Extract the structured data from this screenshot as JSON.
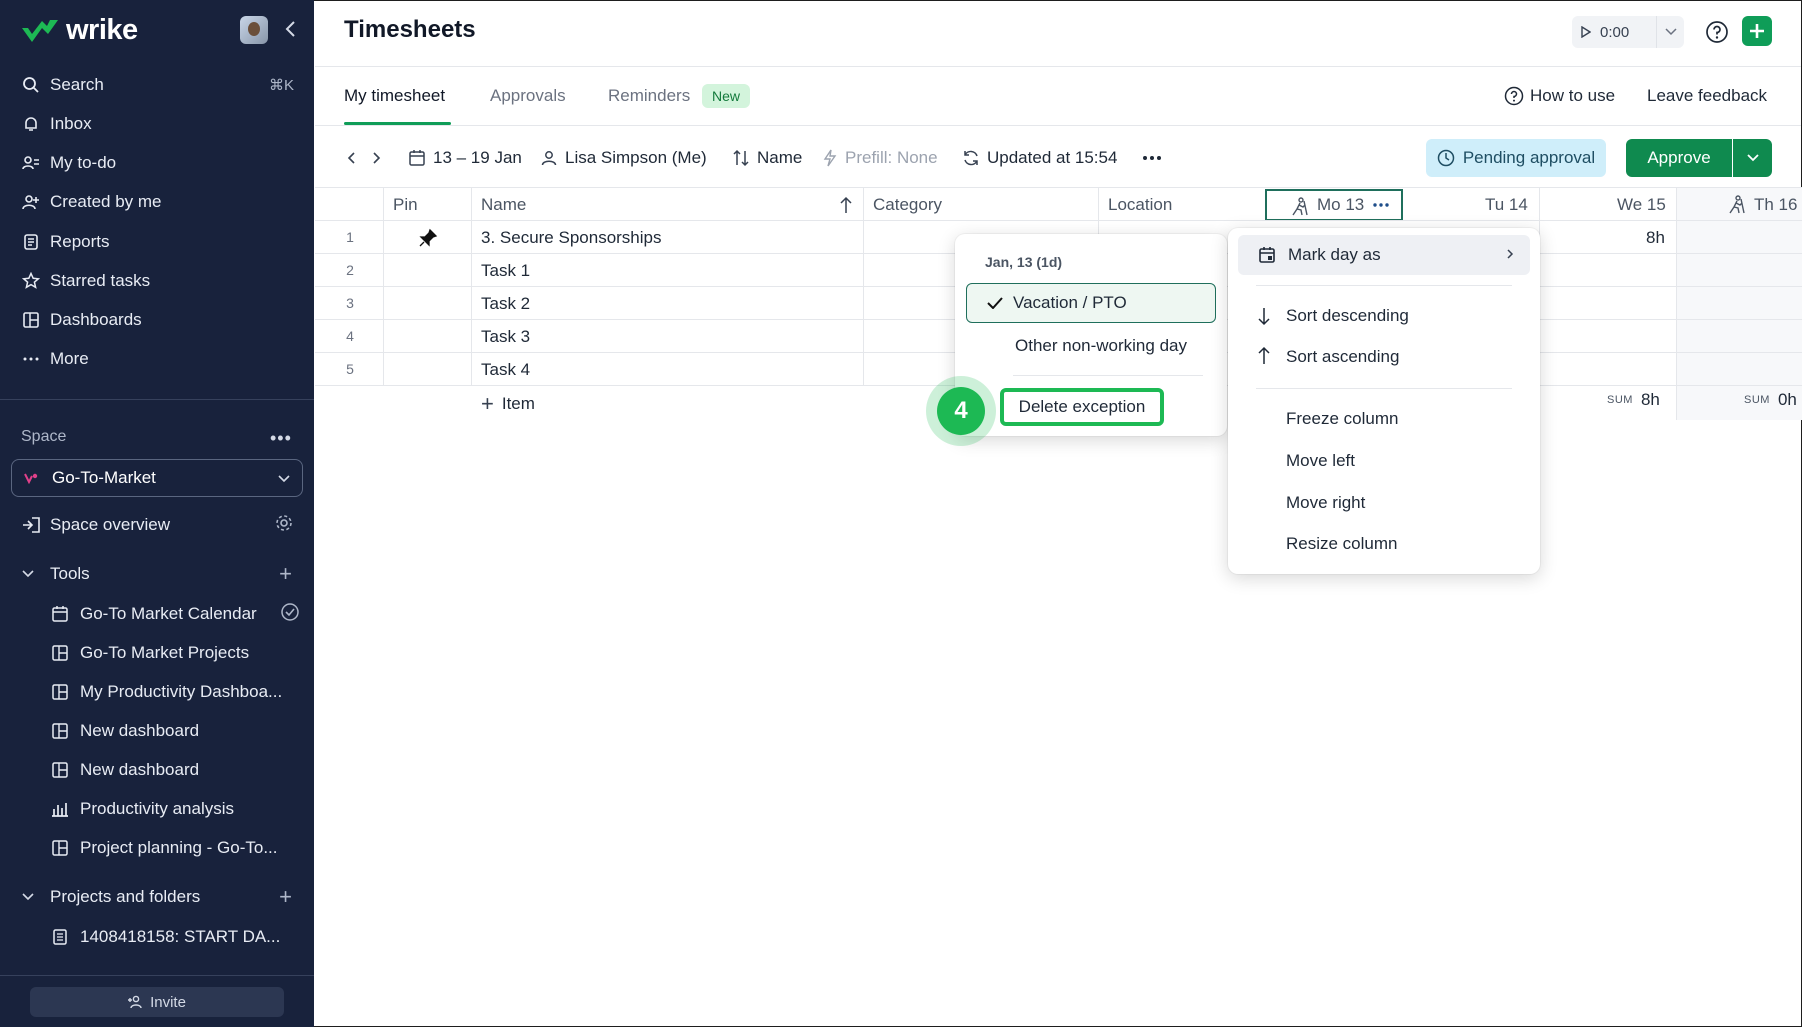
{
  "sidebar": {
    "logo": "wrike",
    "nav": [
      {
        "label": "Search",
        "icon": "search-icon",
        "shortcut": "⌘K"
      },
      {
        "label": "Inbox",
        "icon": "bell-icon"
      },
      {
        "label": "My to-do",
        "icon": "todo-icon"
      },
      {
        "label": "Created by me",
        "icon": "user-plus-icon"
      },
      {
        "label": "Reports",
        "icon": "report-icon"
      },
      {
        "label": "Starred tasks",
        "icon": "star-icon"
      },
      {
        "label": "Dashboards",
        "icon": "dashboard-icon"
      },
      {
        "label": "More",
        "icon": "more-icon"
      }
    ],
    "space_label": "Space",
    "space_name": "Go-To-Market",
    "space_overview": "Space overview",
    "tools_label": "Tools",
    "tools": [
      {
        "label": "Go-To Market Calendar",
        "icon": "calendar-icon"
      },
      {
        "label": "Go-To Market Projects",
        "icon": "board-icon"
      },
      {
        "label": "My Productivity Dashboa...",
        "icon": "board-icon"
      },
      {
        "label": "New dashboard",
        "icon": "board-icon"
      },
      {
        "label": "New dashboard",
        "icon": "board-icon"
      },
      {
        "label": "Productivity analysis",
        "icon": "chart-icon"
      },
      {
        "label": "Project planning - Go-To...",
        "icon": "board-icon"
      }
    ],
    "projects_label": "Projects and folders",
    "projects": [
      {
        "label": "1408418158: START DA...",
        "icon": "project-icon"
      }
    ],
    "invite": "Invite"
  },
  "header": {
    "title": "Timesheets",
    "timer_value": "0:00"
  },
  "tabs": {
    "items": [
      "My timesheet",
      "Approvals",
      "Reminders"
    ],
    "new_badge": "New",
    "how_to_use": "How to use",
    "leave_feedback": "Leave feedback"
  },
  "toolbar": {
    "date_range": "13 – 19 Jan",
    "user": "Lisa Simpson (Me)",
    "sort": "Name",
    "prefill": "Prefill: None",
    "updated": "Updated at 15:54",
    "pending": "Pending approval",
    "approve": "Approve"
  },
  "grid": {
    "columns": {
      "pin": "Pin",
      "name": "Name",
      "category": "Category",
      "location": "Location",
      "mo": "Mo 13",
      "tu": "Tu 14",
      "we": "We 15",
      "th": "Th 16"
    },
    "rows": [
      {
        "num": "1",
        "name": "3. Secure Sponsorships",
        "we": "8h"
      },
      {
        "num": "2",
        "name": "Task 1"
      },
      {
        "num": "3",
        "name": "Task 2"
      },
      {
        "num": "4",
        "name": "Task 3"
      },
      {
        "num": "5",
        "name": "Task 4"
      }
    ],
    "add_item": "Item",
    "sum_label": "SUM",
    "sum_we": "8h",
    "sum_th": "0h"
  },
  "menu_left": {
    "title": "Jan, 13 (1d)",
    "selected": "Vacation / PTO",
    "other": "Other non-working day",
    "delete": "Delete exception",
    "step": "4"
  },
  "menu_right": {
    "mark_day": "Mark day as",
    "sort_desc": "Sort descending",
    "sort_asc": "Sort ascending",
    "freeze": "Freeze column",
    "move_left": "Move left",
    "move_right": "Move right",
    "resize": "Resize column"
  },
  "colors": {
    "sidebar_bg": "#18223c",
    "accent_green": "#0f9d58",
    "highlight_green": "#1db954",
    "pending_bg": "#cfeefa"
  }
}
